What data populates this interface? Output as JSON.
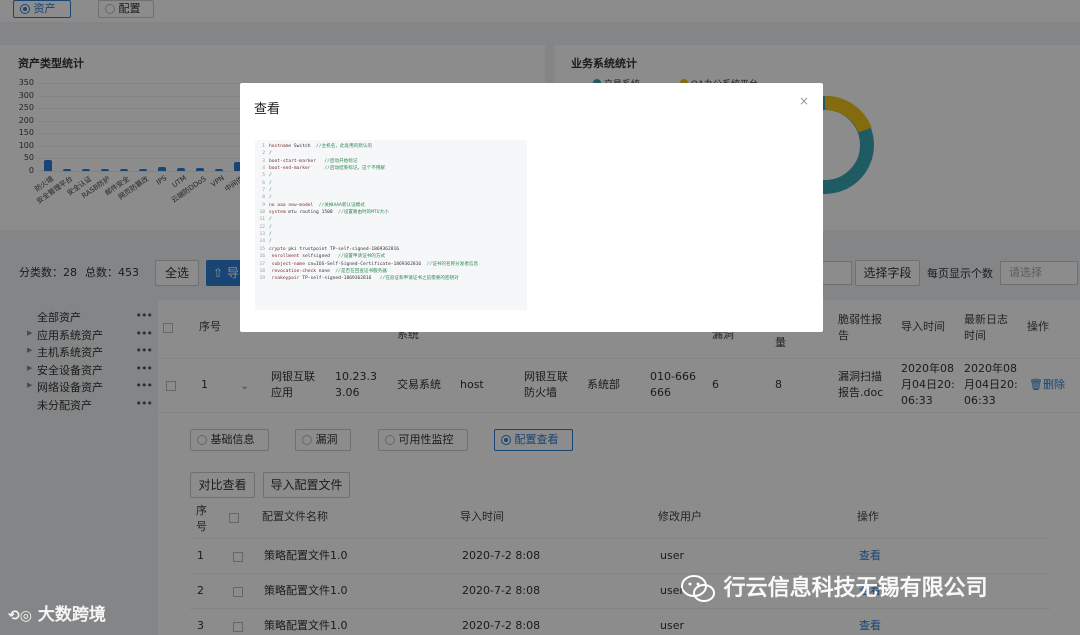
{
  "top_tabs": [
    {
      "label": "资产",
      "selected": true
    },
    {
      "label": "配置",
      "selected": false
    }
  ],
  "asset_type_panel": {
    "title": "资产类型统计"
  },
  "business_panel": {
    "title": "业务系统统计",
    "legend": [
      "交易系统",
      "OA办公系统平台"
    ]
  },
  "chart_data": {
    "type": "bar",
    "title": "资产类型统计",
    "categories": [
      "防火墙",
      "安全管理平台",
      "安全认证",
      "RASB防护",
      "邮件安全",
      "网页防篡改",
      "IPS",
      "UTM",
      "云端防DDoS",
      "VPN",
      "中间件"
    ],
    "values": [
      45,
      8,
      5,
      5,
      6,
      8,
      14,
      12,
      10,
      8,
      35
    ],
    "yticks": [
      0,
      50,
      100,
      150,
      200,
      250,
      300,
      350
    ],
    "ylim": [
      0,
      350
    ],
    "grid": true,
    "bar_color": "#2f7fd6"
  },
  "summary": {
    "category_count": "分类数：28",
    "total_count": "总数：453"
  },
  "toolbar": {
    "select_all": "全选",
    "import_label": "导",
    "select_field": "选择字段",
    "per_page_label": "每页显示个数",
    "per_page_placeholder": "请选择"
  },
  "tree": [
    {
      "label": "全部资产",
      "expandable": false
    },
    {
      "label": "应用系统资产",
      "expandable": true
    },
    {
      "label": "主机系统资产",
      "expandable": true
    },
    {
      "label": "安全设备资产",
      "expandable": true
    },
    {
      "label": "网络设备资产",
      "expandable": true
    },
    {
      "label": "未分配资产",
      "expandable": false
    }
  ],
  "table": {
    "headers": {
      "seq": "序号",
      "system": "系统",
      "vuln": "漏洞",
      "quantity": "量",
      "report": "脆弱性报告",
      "import_time": "导入时间",
      "latest_log": "最新日志时间",
      "action": "操作"
    },
    "row": {
      "seq": "1",
      "name": "网银互联应用",
      "ip": "10.23.33.06",
      "system": "交易系统",
      "type": "host",
      "device": "网银互联防火墙",
      "dept": "系统部",
      "phone": "010-666666",
      "vuln": "6",
      "quantity": "8",
      "report": "漏洞扫描报告.doc",
      "import_time": "2020年08月04日20:06:33",
      "latest_log": "2020年08月04日20:06:33",
      "delete": "删除"
    }
  },
  "detail_tabs": [
    {
      "label": "基础信息",
      "selected": false
    },
    {
      "label": "漏洞",
      "selected": false
    },
    {
      "label": "可用性监控",
      "selected": false
    },
    {
      "label": "配置查看",
      "selected": true
    }
  ],
  "config_actions": {
    "compare": "对比查看",
    "import": "导入配置文件"
  },
  "config_table": {
    "headers": {
      "seq": "序号",
      "name": "配置文件名称",
      "import_time": "导入时间",
      "user": "修改用户",
      "action": "操作"
    },
    "rows": [
      {
        "seq": "1",
        "name": "策略配置文件1.0",
        "time": "2020-7-2 8:08",
        "user": "user",
        "action": "查看"
      },
      {
        "seq": "2",
        "name": "策略配置文件1.0",
        "time": "2020-7-2 8:08",
        "user": "user",
        "action": "查看"
      },
      {
        "seq": "3",
        "name": "策略配置文件1.0",
        "time": "2020-7-2 8:08",
        "user": "user",
        "action": "查看"
      }
    ]
  },
  "modal": {
    "title": "查看",
    "close": "×",
    "code_lines": [
      {
        "n": "1",
        "kw": "hostname",
        "txt": " Switch",
        "cm": "  //主机名，此处用的默认的"
      },
      {
        "n": "2",
        "kw": "",
        "txt": "",
        "cm": "/"
      },
      {
        "n": "3",
        "kw": "boot-start-marker",
        "txt": "",
        "cm": "   //启动开始标记"
      },
      {
        "n": "4",
        "kw": "boot-end-marker",
        "txt": "",
        "cm": "     //启动结束标记，这个不用解"
      },
      {
        "n": "5",
        "kw": "",
        "txt": "",
        "cm": "/"
      },
      {
        "n": "6",
        "kw": "",
        "txt": "",
        "cm": "/"
      },
      {
        "n": "7",
        "kw": "",
        "txt": "",
        "cm": "/"
      },
      {
        "n": "8",
        "kw": "",
        "txt": "",
        "cm": "/"
      },
      {
        "n": "9",
        "kw": "no aaa new-model",
        "txt": "",
        "cm": "  //关掉AAA新认证模式"
      },
      {
        "n": "10",
        "kw": "system",
        "txt": " mtu routing 1500",
        "cm": "  //设置路由时的MTU大小"
      },
      {
        "n": "11",
        "kw": "",
        "txt": "",
        "cm": "/"
      },
      {
        "n": "12",
        "kw": "",
        "txt": "",
        "cm": "/"
      },
      {
        "n": "13",
        "kw": "",
        "txt": "",
        "cm": "/"
      },
      {
        "n": "14",
        "kw": "",
        "txt": "",
        "cm": "/"
      },
      {
        "n": "15",
        "kw": "crypto",
        "txt": " pki trustpoint TP-self-signed-1869362816",
        "cm": ""
      },
      {
        "n": "16",
        "kw": " enrollment",
        "txt": " selfsigned",
        "cm": "   //设置申请证书的方式"
      },
      {
        "n": "17",
        "kw": " subject-name",
        "txt": " cn=IOS-Self-Signed-Certificate-1869362816",
        "cm": "  //证书的名称分发者信息"
      },
      {
        "n": "18",
        "kw": " revocation-check",
        "txt": " none",
        "cm": "  //是否在回查证书服务器"
      },
      {
        "n": "19",
        "kw": " rsakeypair",
        "txt": " TP-self-signed-1869362816",
        "cm": "   //在验证和申请证书之前需要的密钥对"
      }
    ]
  },
  "watermark": {
    "left": "大数跨境",
    "right": "行云信息科技无锡有限公司"
  }
}
